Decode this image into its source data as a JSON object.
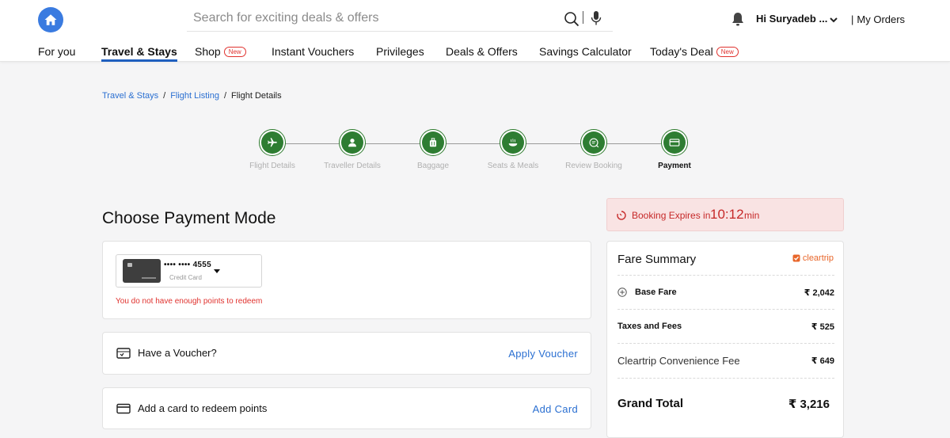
{
  "header": {
    "search_placeholder": "Search for exciting deals & offers",
    "greeting": "Hi Suryadeb ...",
    "orders_separator": "|",
    "orders_label": "My Orders",
    "home_icon": "home-icon",
    "search_icon": "search-icon",
    "mic_icon": "mic-icon",
    "bell_icon": "bell-icon"
  },
  "nav": {
    "items": [
      {
        "label": "For you"
      },
      {
        "label": "Travel & Stays",
        "active": true
      },
      {
        "label": "Shop",
        "badge": "New"
      },
      {
        "label": "Instant Vouchers"
      },
      {
        "label": "Privileges"
      },
      {
        "label": "Deals & Offers"
      },
      {
        "label": "Savings Calculator"
      },
      {
        "label": "Today's Deal",
        "badge": "New"
      }
    ]
  },
  "breadcrumb": {
    "items": [
      "Travel & Stays",
      "Flight Listing",
      "Flight Details"
    ],
    "separator": "/"
  },
  "stepper": {
    "steps": [
      {
        "label": "Flight Details",
        "icon": "plane-icon"
      },
      {
        "label": "Traveller Details",
        "icon": "person-icon"
      },
      {
        "label": "Baggage",
        "icon": "baggage-icon"
      },
      {
        "label": "Seats & Meals",
        "icon": "meal-icon"
      },
      {
        "label": "Review Booking",
        "icon": "review-icon"
      },
      {
        "label": "Payment",
        "icon": "card-icon",
        "current": true
      }
    ]
  },
  "payment": {
    "title": "Choose Payment Mode",
    "card_number": "•••• •••• 4555",
    "card_type": "Credit Card",
    "points_error": "You do not have enough points to redeem",
    "voucher_label": "Have a Voucher?",
    "voucher_action": "Apply Voucher",
    "add_card_label": "Add a card to redeem points",
    "add_card_action": "Add Card"
  },
  "expiry": {
    "label": "Booking Expires in",
    "time": "10:12",
    "unit": "min"
  },
  "fare": {
    "title": "Fare Summary",
    "provider": "cleartrip",
    "base_fare_label": "Base Fare",
    "base_fare_value": "₹ 2,042",
    "taxes_label": "Taxes and Fees",
    "taxes_value": "₹ 525",
    "convenience_label": "Cleartrip Convenience Fee",
    "convenience_value": "₹ 649",
    "total_label": "Grand Total",
    "total_value": "₹ 3,216"
  },
  "colors": {
    "accent_blue": "#2a6fd1",
    "step_green": "#2e7d32",
    "error_red": "#e0322e",
    "cleartrip_orange": "#e8662a",
    "expiry_bg": "#f9e3e3"
  }
}
